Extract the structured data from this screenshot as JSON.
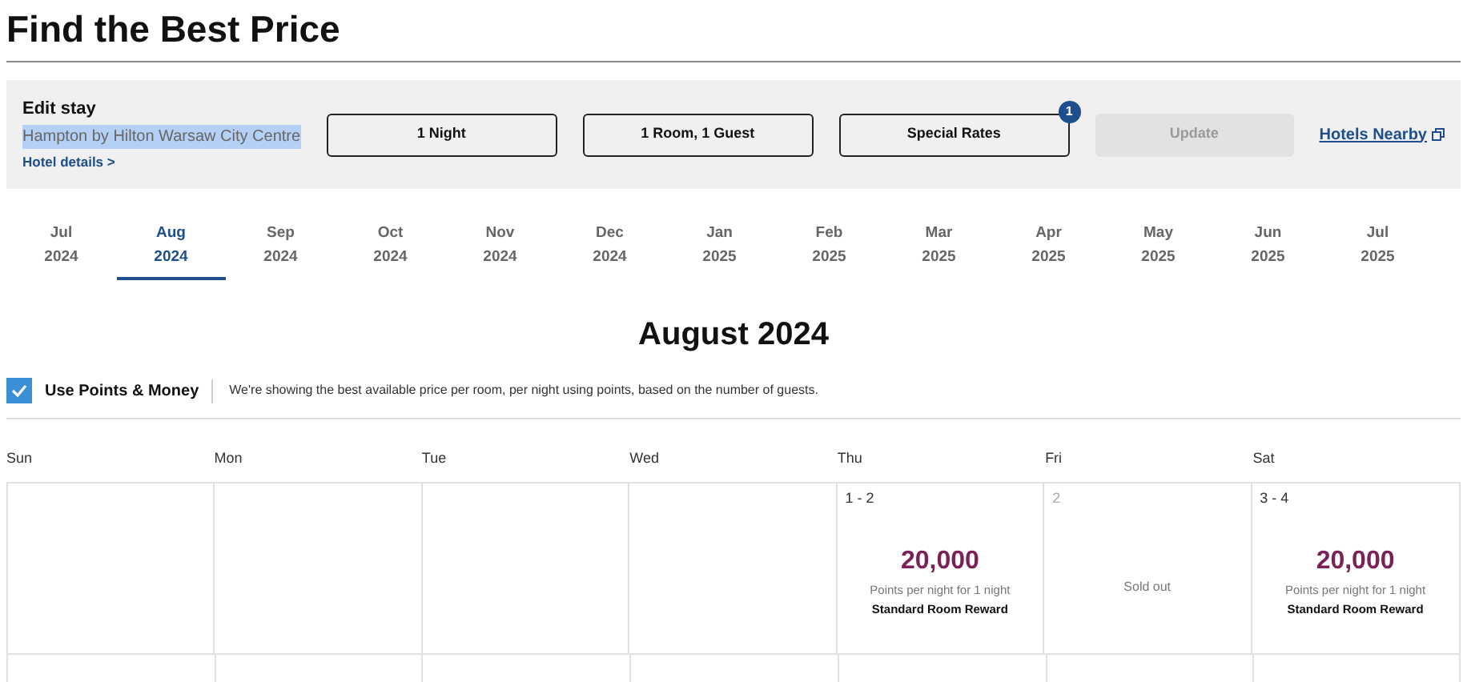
{
  "title": "Find the Best Price",
  "edit_stay": {
    "heading": "Edit stay",
    "hotel_name": {
      "text": "Hampton by Hilton Warsaw City Centre",
      "highlighted": true
    },
    "details_link": "Hotel details >",
    "buttons": [
      {
        "label": "1 Night"
      },
      {
        "label": "1 Room, 1 Guest"
      },
      {
        "label": "Special Rates",
        "badge": "1"
      }
    ],
    "update": {
      "label": "Update",
      "disabled": true
    },
    "nearby_link": "Hotels Nearby"
  },
  "months": [
    {
      "month": "Jul",
      "year": "2024",
      "selected": false
    },
    {
      "month": "Aug",
      "year": "2024",
      "selected": true
    },
    {
      "month": "Sep",
      "year": "2024",
      "selected": false
    },
    {
      "month": "Oct",
      "year": "2024",
      "selected": false
    },
    {
      "month": "Nov",
      "year": "2024",
      "selected": false
    },
    {
      "month": "Dec",
      "year": "2024",
      "selected": false
    },
    {
      "month": "Jan",
      "year": "2025",
      "selected": false
    },
    {
      "month": "Feb",
      "year": "2025",
      "selected": false
    },
    {
      "month": "Mar",
      "year": "2025",
      "selected": false
    },
    {
      "month": "Apr",
      "year": "2025",
      "selected": false
    },
    {
      "month": "May",
      "year": "2025",
      "selected": false
    },
    {
      "month": "Jun",
      "year": "2025",
      "selected": false
    },
    {
      "month": "Jul",
      "year": "2025",
      "selected": false
    }
  ],
  "calendar_title": "August 2024",
  "points_toggle": {
    "label": "Use Points & Money",
    "checked": true,
    "note": "We're showing the best available price per room, per night using points, based on the number of guests."
  },
  "weekdays": [
    "Sun",
    "Mon",
    "Tue",
    "Wed",
    "Thu",
    "Fri",
    "Sat"
  ],
  "days": [
    {
      "kind": "empty"
    },
    {
      "kind": "empty"
    },
    {
      "kind": "empty"
    },
    {
      "kind": "empty"
    },
    {
      "kind": "price",
      "dates": "1 - 2",
      "price": "20,000",
      "caption": "Points per night for 1 night",
      "rate": "Standard Room Reward"
    },
    {
      "kind": "sold_out",
      "dates": "2",
      "status": "Sold out"
    },
    {
      "kind": "price",
      "dates": "3 - 4",
      "price": "20,000",
      "caption": "Points per night for 1 night",
      "rate": "Standard Room Reward"
    }
  ]
}
